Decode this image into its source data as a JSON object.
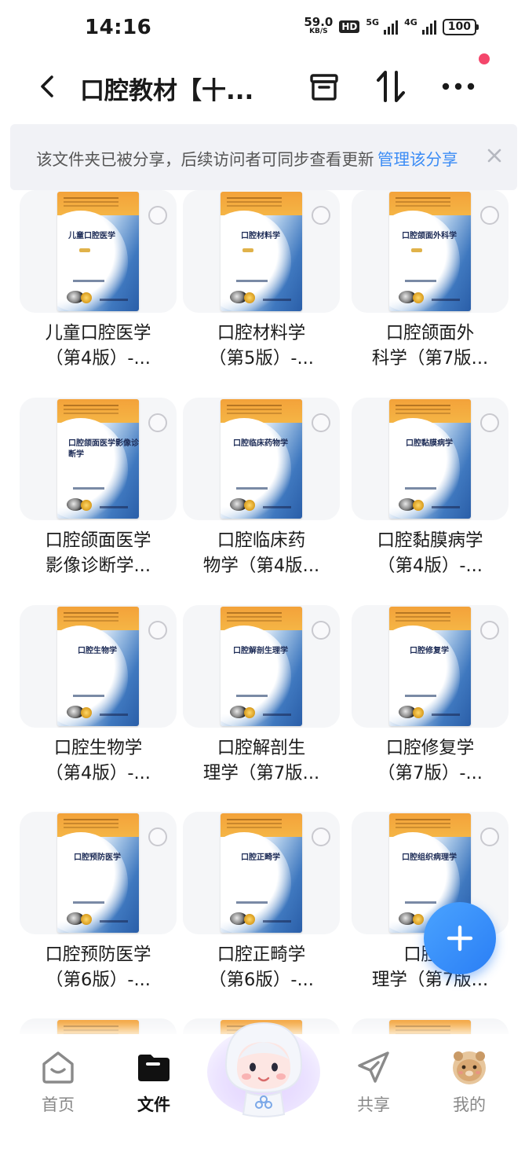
{
  "status_bar": {
    "time": "14:16",
    "net_speed_value": "59.0",
    "net_speed_unit": "KB/S",
    "hd_label": "HD",
    "signal1_label": "5G",
    "signal2_label": "4G",
    "battery": "100"
  },
  "header": {
    "title": "口腔教材【十...",
    "icons": [
      "back-icon",
      "archive-icon",
      "sort-icon",
      "more-icon"
    ]
  },
  "banner": {
    "text": "该文件夹已被分享，后续访问者可同步查看更新",
    "link": "管理该分享"
  },
  "files": [
    {
      "cover_title": "儿童口腔医学",
      "name_line1": "儿童口腔医学",
      "name_line2": "（第4版）-..."
    },
    {
      "cover_title": "口腔材料学",
      "name_line1": "口腔材料学",
      "name_line2": "（第5版）-..."
    },
    {
      "cover_title": "口腔颌面外科学",
      "name_line1": "口腔颌面外",
      "name_line2": "科学（第7版..."
    },
    {
      "cover_title": "口腔颌面医学影像诊断学",
      "name_line1": "口腔颌面医学",
      "name_line2": "影像诊断学..."
    },
    {
      "cover_title": "口腔临床药物学",
      "name_line1": "口腔临床药",
      "name_line2": "物学（第4版..."
    },
    {
      "cover_title": "口腔黏膜病学",
      "name_line1": "口腔黏膜病学",
      "name_line2": "（第4版）-..."
    },
    {
      "cover_title": "口腔生物学",
      "name_line1": "口腔生物学",
      "name_line2": "（第4版）-..."
    },
    {
      "cover_title": "口腔解剖生理学",
      "name_line1": "口腔解剖生",
      "name_line2": "理学（第7版..."
    },
    {
      "cover_title": "口腔修复学",
      "name_line1": "口腔修复学",
      "name_line2": "（第7版）-..."
    },
    {
      "cover_title": "口腔预防医学",
      "name_line1": "口腔预防医学",
      "name_line2": "（第6版）-..."
    },
    {
      "cover_title": "口腔正畸学",
      "name_line1": "口腔正畸学",
      "name_line2": "（第6版）-..."
    },
    {
      "cover_title": "口腔组织病理学",
      "name_line1": "口腔组",
      "name_line2": "理学（第7版..."
    }
  ],
  "bottom_nav": {
    "items": [
      {
        "label": "首页",
        "icon": "home-icon",
        "active": false
      },
      {
        "label": "文件",
        "icon": "folder-icon",
        "active": true
      },
      {
        "label": "共享",
        "icon": "share-icon",
        "active": false
      },
      {
        "label": "我的",
        "icon": "avatar-icon",
        "active": false
      }
    ]
  },
  "colors": {
    "accent": "#3b8cf5",
    "fab": "#2a7ef5",
    "notification_dot": "#f4466b",
    "banner_bg": "#f1f2f6"
  }
}
